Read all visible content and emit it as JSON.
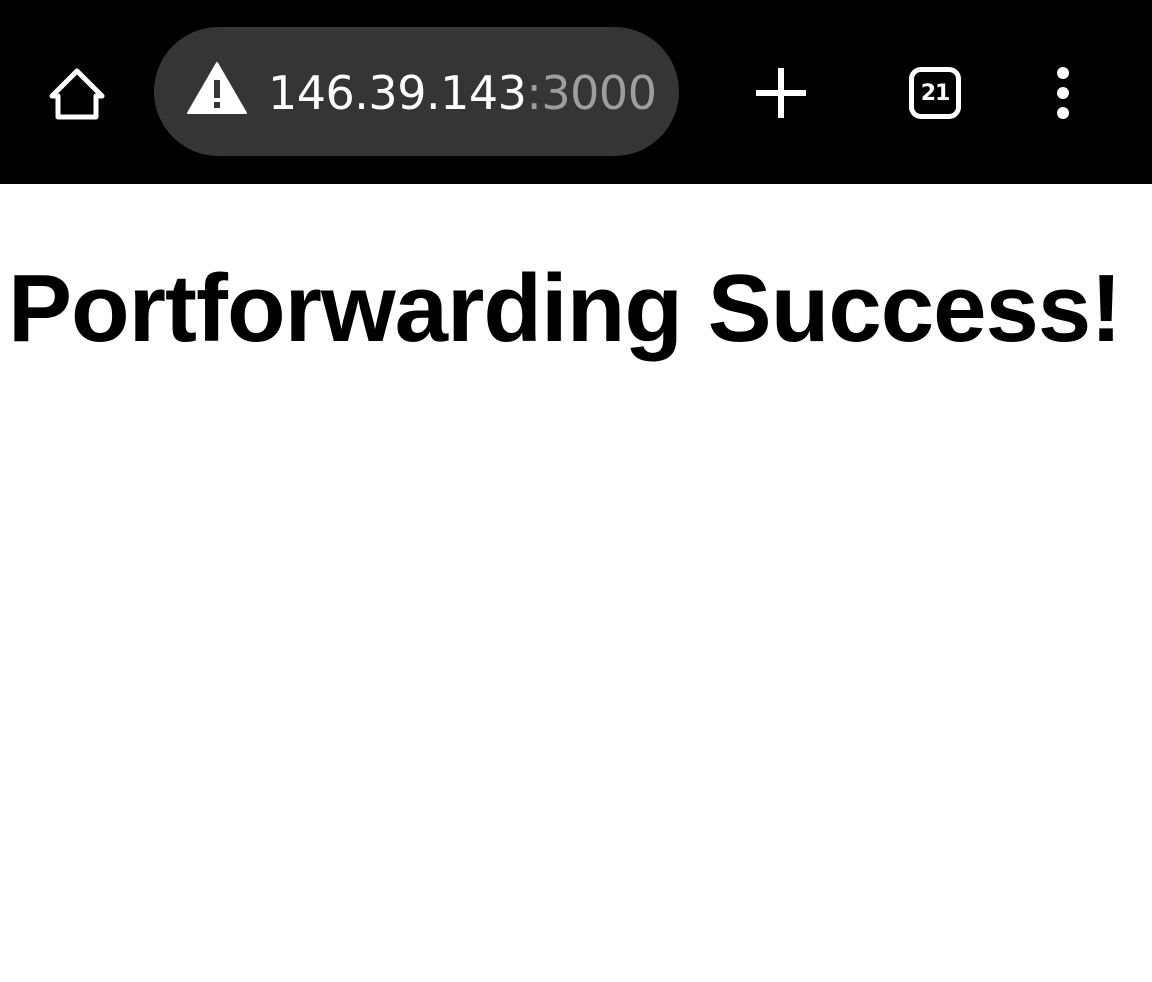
{
  "browser": {
    "address_bar": {
      "host": "146.39.143",
      "port": ":3000",
      "security_icon": "warning-triangle-icon"
    },
    "tab_count": "21",
    "icons": {
      "home": "home-icon",
      "new_tab": "plus-icon",
      "menu": "more-vert-icon"
    },
    "colors": {
      "toolbar_bg": "#000000",
      "omnibox_bg": "#353535",
      "port_text": "#9e9e9e"
    }
  },
  "page": {
    "heading": "Portforwarding Success!"
  }
}
